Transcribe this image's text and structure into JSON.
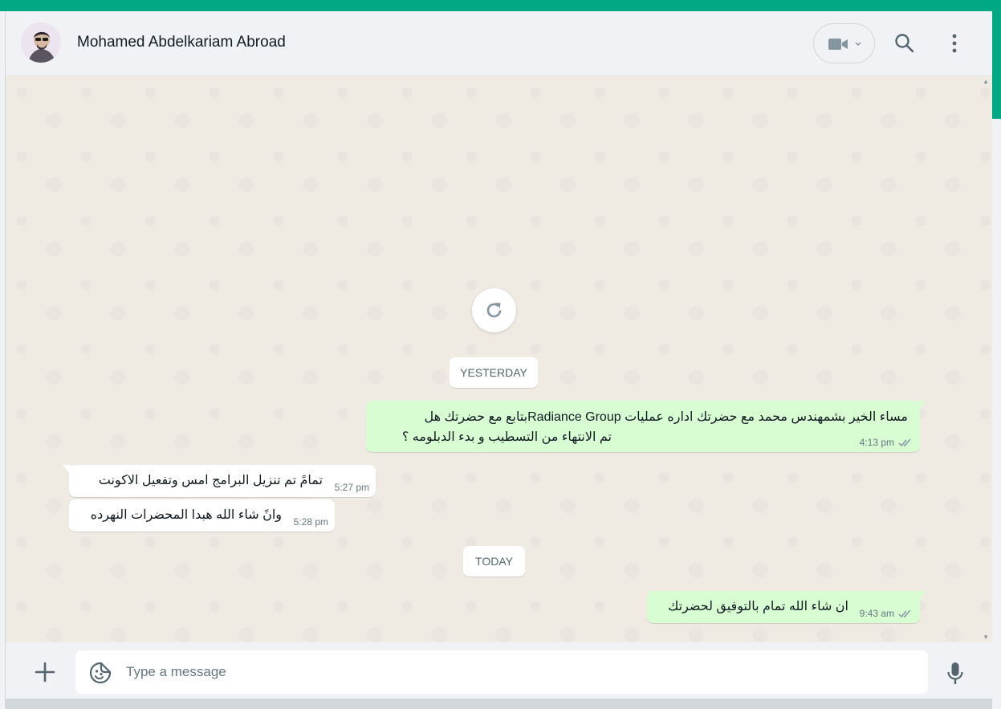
{
  "colors": {
    "accent": "#00a884",
    "outgoing_bubble": "#d9fdd3",
    "incoming_bubble": "#ffffff",
    "chat_bg": "#efeae2"
  },
  "header": {
    "contact_name": "Mohamed Abdelkariam Abroad",
    "icons": [
      "avatar",
      "video-call-icon",
      "chevron-down-icon",
      "search-icon",
      "menu-icon"
    ]
  },
  "chat": {
    "reload_icon": "refresh-icon",
    "dates": {
      "yesterday": "YESTERDAY",
      "today": "TODAY"
    },
    "messages": [
      {
        "direction": "out",
        "line1": "مساء الخير بشمهندس محمد مع  حضرتك اداره عمليات Radiance Groupبتابع مع حضرتك هل",
        "line2": "تم الانتهاء من التسطيب و بدء الدبلومه ؟",
        "time": "4:13 pm",
        "status": "read"
      },
      {
        "direction": "in",
        "text": "تمامً تم تنزيل البرامج امس وتفعيل الاكونت",
        "time": "5:27 pm"
      },
      {
        "direction": "in",
        "text": "وانً شاء الله هبدا المحضرات النهرده",
        "time": "5:28 pm"
      },
      {
        "direction": "out",
        "text": "ان شاء الله تمام بالتوفيق لحضرتك",
        "time": "9:43 am",
        "status": "read"
      }
    ]
  },
  "footer": {
    "placeholder": "Type a message",
    "icons": [
      "plus-icon",
      "sticker-icon",
      "microphone-icon"
    ]
  }
}
